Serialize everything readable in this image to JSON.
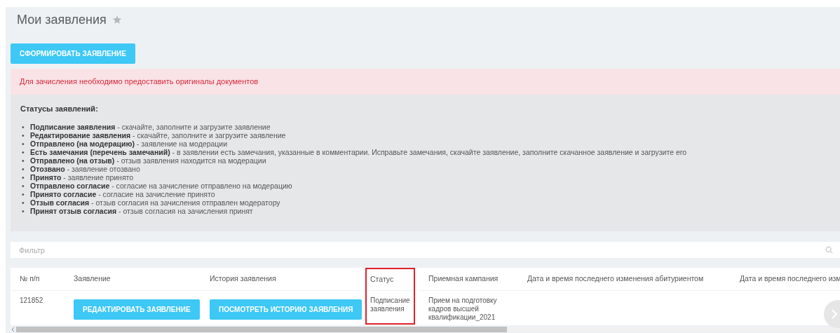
{
  "page": {
    "title": "Мои заявления",
    "favorite": false
  },
  "create_button": "СФОРМИРОВАТЬ ЗАЯВЛЕНИЕ",
  "alert": "Для зачисления необходимо предоставить оригиналы документов",
  "statuses": {
    "heading": "Статусы заявлений:",
    "marker": "•",
    "items": [
      "**Подписание заявления** - скачайте, заполните и загрузите заявление",
      "**Редактирование заявления** - скачайте, заполните и загрузите заявление",
      "**Отправлено (на модерацию)** - заявление на модерации",
      "**Есть замечания (перечень замечаний)** - в заявлении есть замечания, указанные в комментарии. Исправьте замечания, скачайте заявление, заполните скачанное заявление и загрузите его",
      "**Отправлено (на отзыв)** - отзыв заявления находится на модерации",
      "**Отозвано** - заявление отозвано",
      "**Принято** - заявление принято",
      "**Отправлено согласие** - согласие на зачисление отправлено на модерацию",
      "**Принято согласие** - согласие на зачисление принято",
      "**Отзыв согласия** - отзыв согласия на зачисления отправлен модератору",
      "**Принят отзыв согласия** - отзыв согласия на зачисления принят"
    ]
  },
  "filter": {
    "placeholder": "Фильтр"
  },
  "table": {
    "columns": [
      {
        "label": "№ п/п",
        "highlighted": false
      },
      {
        "label": "Заявление",
        "highlighted": false
      },
      {
        "label": "История заявления",
        "highlighted": false
      },
      {
        "label": "Статус",
        "highlighted": true
      },
      {
        "label": "Приемная кампания",
        "highlighted": false
      },
      {
        "label": "Дата и время последнего изменения абитуриентом",
        "highlighted": false
      },
      {
        "label": "Дата и время последнего изм",
        "highlighted": false
      }
    ],
    "rows": [
      {
        "cells": [
          {
            "kind": "text",
            "text": "121852"
          },
          {
            "kind": "button",
            "text": "РЕДАКТИРОВАТЬ ЗАЯВЛЕНИЕ"
          },
          {
            "kind": "button",
            "text": "ПОСМОТРЕТЬ ИСТОРИЮ ЗАЯВЛЕНИЯ"
          },
          {
            "kind": "text",
            "text": "Подписание заявления"
          },
          {
            "kind": "text",
            "text": "Прием на подготовку кадров высшей квалификации_2021"
          }
        ]
      }
    ]
  }
}
